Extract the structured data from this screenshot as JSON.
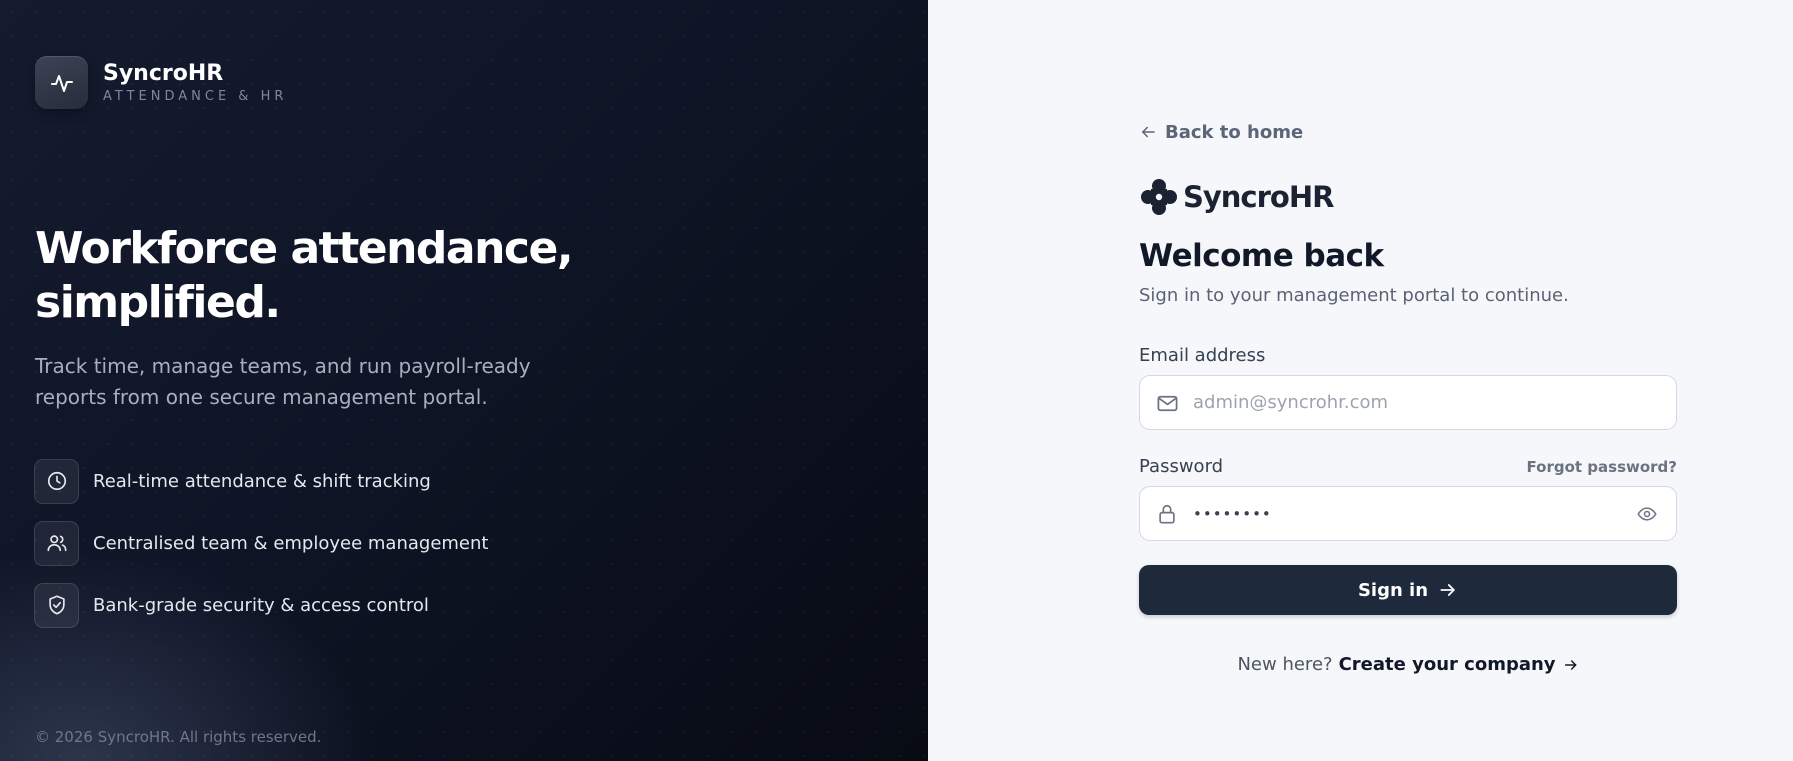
{
  "brand": {
    "name": "SyncroHR",
    "tagline": "ATTENDANCE & HR",
    "icon": "activity-pulse-icon"
  },
  "hero": {
    "title_line1": "Workforce attendance,",
    "title_line2": "simplified.",
    "description": "Track time, manage teams, and run payroll-ready reports from one secure management portal."
  },
  "features": [
    {
      "icon": "clock-icon",
      "label": "Real-time attendance & shift tracking"
    },
    {
      "icon": "users-icon",
      "label": "Centralised team & employee management"
    },
    {
      "icon": "shield-check-icon",
      "label": "Bank-grade security & access control"
    }
  ],
  "copyright": "© 2026 SyncroHR. All rights reserved.",
  "login": {
    "back_label": "Back to home",
    "logo_text": "SyncroHR",
    "title": "Welcome back",
    "subtitle": "Sign in to your management portal to continue.",
    "email": {
      "label": "Email address",
      "placeholder": "admin@syncrohr.com",
      "value": ""
    },
    "password": {
      "label": "Password",
      "value": "••••••••",
      "forgot_label": "Forgot password?"
    },
    "submit_label": "Sign in",
    "new_here": "New here?",
    "create_label": "Create your company"
  },
  "colors": {
    "left_bg": "#0f1526",
    "right_bg": "#f5f7fa",
    "primary_button": "#1e293b",
    "heading": "#111827",
    "muted": "#5a6374"
  }
}
